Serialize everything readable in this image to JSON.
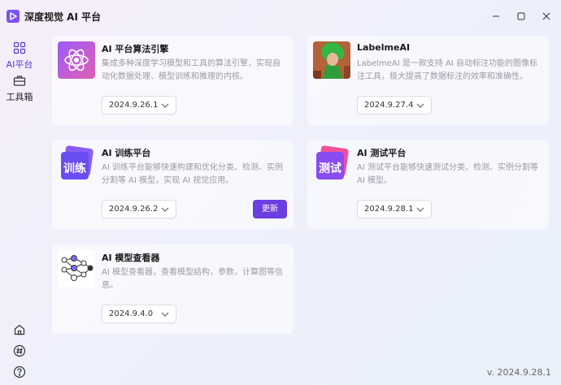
{
  "app": {
    "title": "深度视觉 AI 平台",
    "version": "v. 2024.9.28.1"
  },
  "colors": {
    "accent": "#6a3fe0",
    "nav_active": "#4e3bd9"
  },
  "sidebar": {
    "items": [
      {
        "label": "AI平台",
        "icon": "grid-icon",
        "active": true
      },
      {
        "label": "工具箱",
        "icon": "toolbox-icon",
        "active": false
      }
    ],
    "bottom_icons": [
      "home-icon",
      "hash-icon",
      "help-icon"
    ]
  },
  "cards": [
    {
      "id": "engine",
      "title": "AI 平台算法引擎",
      "desc": "集成多种深度学习模型和工具的算法引擎，实现自动化数据处理、模型训练和推理的内核。",
      "version": "2024.9.26.1",
      "icon": "atom-icon"
    },
    {
      "id": "labelme",
      "title": "LabelmeAI",
      "desc": "LabelmeAI 是一款支持 AI 自动标注功能的图像标注工具，极大提高了数据标注的效率和准确性。",
      "version": "2024.9.27.4",
      "icon": "labelme-image"
    },
    {
      "id": "train",
      "title": "AI 训练平台",
      "desc": "AI 训练平台能够快速构建和优化分类、检测、实例分割等 AI 模型，实现 AI 视觉应用。",
      "version": "2024.9.26.2",
      "icon": "train-icon",
      "icon_text": "训练",
      "update_label": "更新"
    },
    {
      "id": "test",
      "title": "AI 测试平台",
      "desc": "AI 测试平台能够快速测试分类、检测、实例分割等 AI 模型。",
      "version": "2024.9.28.1",
      "icon": "test-icon",
      "icon_text": "测试"
    },
    {
      "id": "viewer",
      "title": "AI 模型查看器",
      "desc": "AI 模型查看器，查看模型结构，参数，计算图等信息。",
      "version": "2024.9.4.0",
      "icon": "network-graph-icon"
    }
  ]
}
